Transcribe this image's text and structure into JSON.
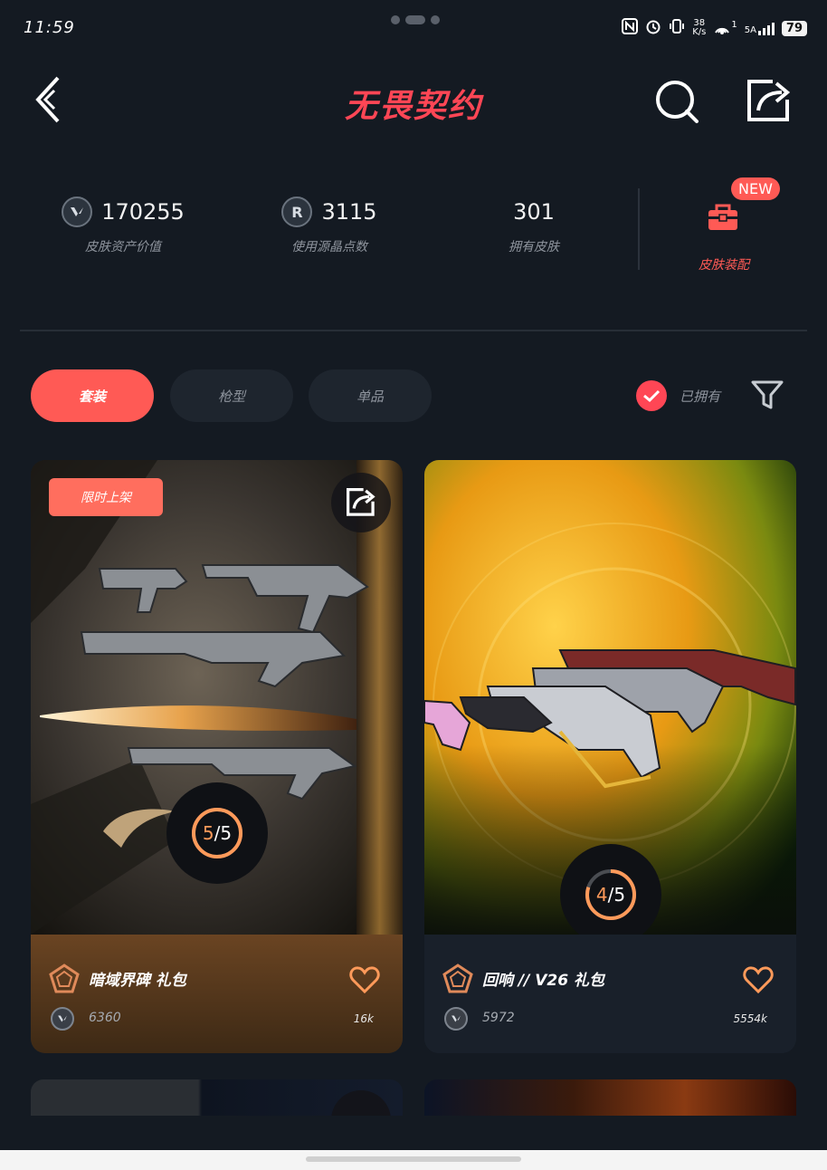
{
  "status_bar": {
    "time": "11:59",
    "net_speed_value": "38",
    "net_speed_unit": "K/s",
    "hotspot_count": "1",
    "network_type": "5A",
    "battery": "79"
  },
  "header": {
    "title": "无畏契约"
  },
  "stats": [
    {
      "value": "170255",
      "label": "皮肤资产价值",
      "icon": "vp-coin-icon"
    },
    {
      "value": "3115",
      "label": "使用源晶点数",
      "icon": "radianite-coin-icon"
    },
    {
      "value": "301",
      "label": "拥有皮肤"
    }
  ],
  "loadout": {
    "badge": "NEW",
    "label": "皮肤装配"
  },
  "tabs": [
    {
      "label": "套装",
      "active": true
    },
    {
      "label": "枪型",
      "active": false
    },
    {
      "label": "单品",
      "active": false
    }
  ],
  "owned_filter": {
    "label": "已拥有",
    "checked": true
  },
  "cards": [
    {
      "badge": "限时上架",
      "progress_owned": "5",
      "progress_sep": "/",
      "progress_total": "5",
      "name": "暗域界碑 礼包",
      "price": "6360",
      "likes": "16k"
    },
    {
      "progress_owned": "4",
      "progress_sep": "/",
      "progress_total": "5",
      "name": "回响 // V26 礼包",
      "price": "5972",
      "likes": "5554k"
    }
  ],
  "colors": {
    "accent": "#ff4655",
    "tab_active": "#ff5a55",
    "progress": "#ff9a5a",
    "background": "#141a22"
  }
}
